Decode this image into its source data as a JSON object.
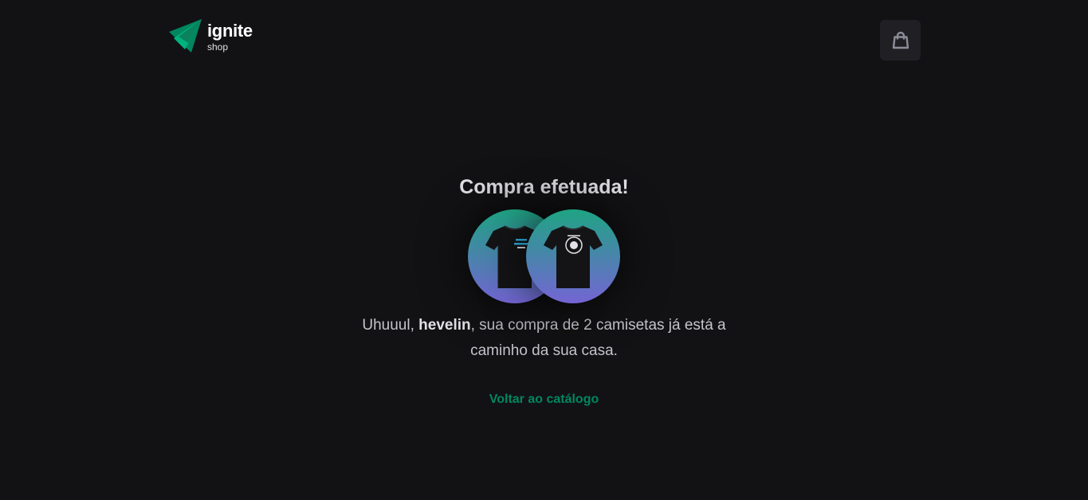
{
  "header": {
    "logo_title": "ignite",
    "logo_subtitle": "shop",
    "cart_icon": "shopping-bag-icon"
  },
  "success": {
    "title": "Compra efetuada!",
    "message_prefix": "Uhuuul, ",
    "customer_name": "hevelin",
    "message_suffix": ", sua compra de 2 camisetas já está a caminho da sua casa.",
    "back_link": "Voltar ao catálogo",
    "products": [
      {
        "icon": "tshirt-icon",
        "print": "text-logo"
      },
      {
        "icon": "tshirt-icon",
        "print": "round-emblem"
      }
    ]
  },
  "colors": {
    "background": "#121214",
    "accent": "#00875f",
    "gradient_top": "#1ea483",
    "gradient_bottom": "#7465d4",
    "cart_button_bg": "#202024"
  }
}
